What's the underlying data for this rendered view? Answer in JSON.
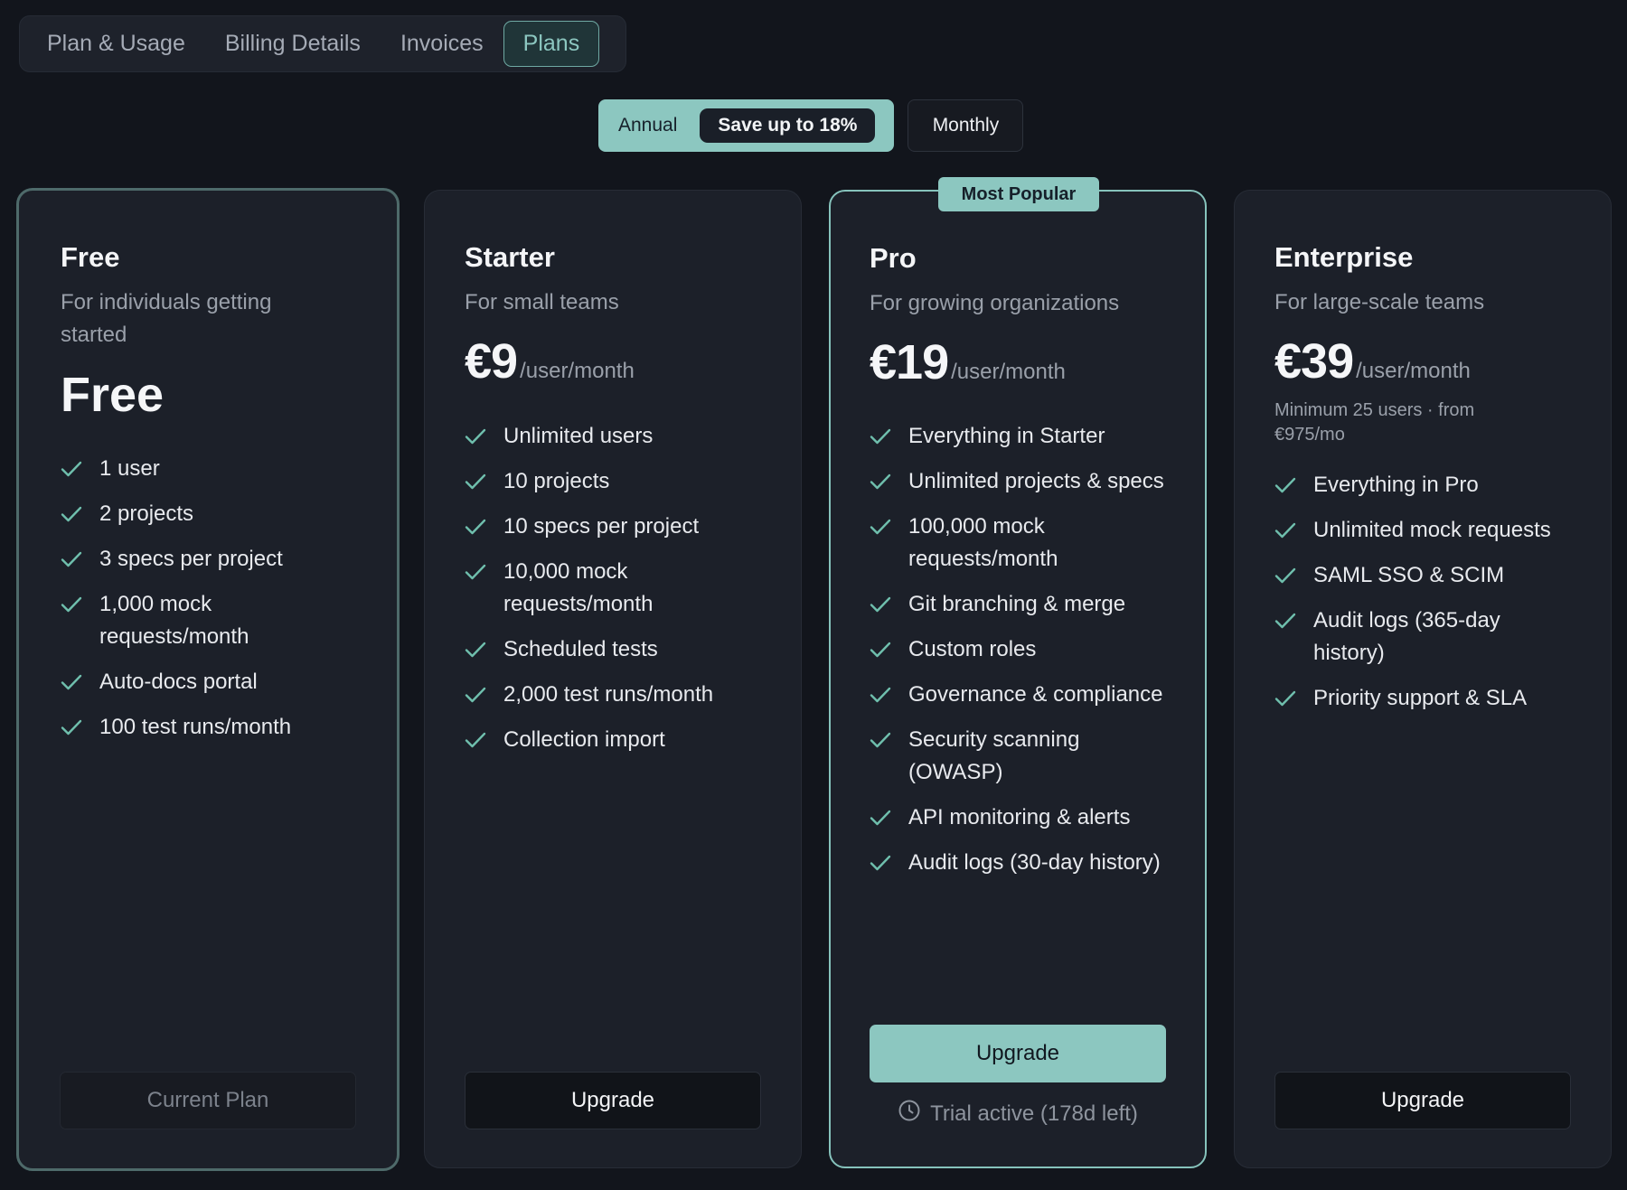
{
  "tabs": [
    "Plan & Usage",
    "Billing Details",
    "Invoices",
    "Plans"
  ],
  "active_tab": "Plans",
  "billing": {
    "annual_label": "Annual",
    "save_label": "Save up to 18%",
    "monthly_label": "Monthly"
  },
  "colors": {
    "accent": "#8cc7c0",
    "background": "#12151c",
    "card": "#1c2029"
  },
  "plans": {
    "free": {
      "name": "Free",
      "description": "For individuals getting started",
      "price_label": "Free",
      "features": [
        "1 user",
        "2 projects",
        "3 specs per project",
        "1,000 mock requests/month",
        "Auto-docs portal",
        "100 test runs/month"
      ],
      "button": "Current Plan"
    },
    "starter": {
      "name": "Starter",
      "description": "For small teams",
      "price": "€9",
      "per": "/user/month",
      "features": [
        "Unlimited users",
        "10 projects",
        "10 specs per project",
        "10,000 mock requests/month",
        "Scheduled tests",
        "2,000 test runs/month",
        "Collection import"
      ],
      "button": "Upgrade"
    },
    "pro": {
      "badge": "Most Popular",
      "name": "Pro",
      "description": "For growing organizations",
      "price": "€19",
      "per": "/user/month",
      "features": [
        "Everything in Starter",
        "Unlimited projects & specs",
        "100,000 mock requests/month",
        "Git branching & merge",
        "Custom roles",
        "Governance & compliance",
        "Security scanning (OWASP)",
        "API monitoring & alerts",
        "Audit logs (30-day history)"
      ],
      "button": "Upgrade",
      "trial": "Trial active (178d left)",
      "trial_icon": "clock-icon"
    },
    "enterprise": {
      "name": "Enterprise",
      "description": "For large-scale teams",
      "price": "€39",
      "per": "/user/month",
      "note": "Minimum 25 users · from €975/mo",
      "features": [
        "Everything in Pro",
        "Unlimited mock requests",
        "SAML SSO & SCIM",
        "Audit logs (365-day history)",
        "Priority support & SLA"
      ],
      "button": "Upgrade"
    }
  },
  "feature_icon": "check-icon"
}
